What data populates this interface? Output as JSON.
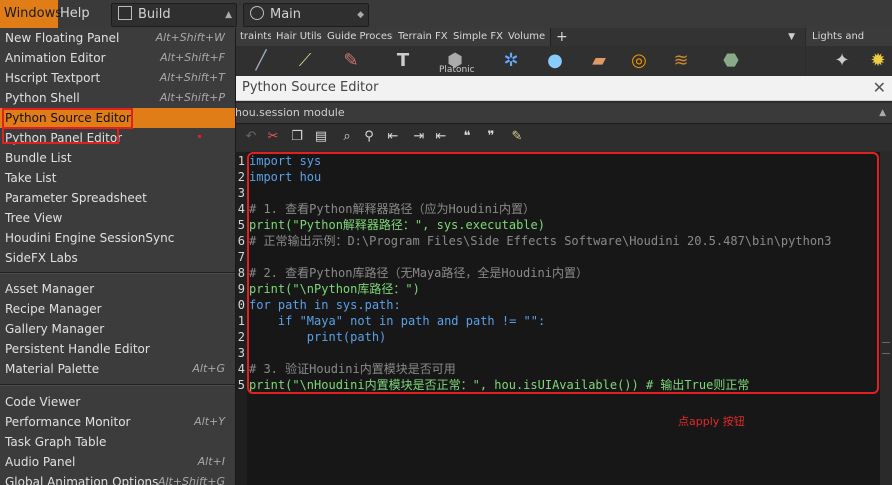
{
  "menubar": {
    "windows": "Windows",
    "help": "Help",
    "desktop_dropdown": "Build",
    "pane_dropdown": "Main"
  },
  "shelf": {
    "tabs": [
      "traints",
      "Hair Utils",
      "Guide Process",
      "Terrain FX",
      "Simple FX",
      "Volume"
    ],
    "add_label": "+",
    "visible_tool_label": "Platonic",
    "second_tab": "Lights and Cameras"
  },
  "menu": {
    "items": [
      {
        "label": "New Floating Panel",
        "shortcut": "Alt+Shift+W"
      },
      {
        "label": "Animation Editor",
        "shortcut": "Alt+Shift+F"
      },
      {
        "label": "Hscript Textport",
        "shortcut": "Alt+Shift+T"
      },
      {
        "label": "Python Shell",
        "shortcut": "Alt+Shift+P"
      },
      {
        "label": "Python Source Editor",
        "shortcut": ""
      },
      {
        "label": "Python Panel Editor",
        "shortcut": ""
      },
      {
        "label": "Bundle List",
        "shortcut": ""
      },
      {
        "label": "Take List",
        "shortcut": ""
      },
      {
        "label": "Parameter Spreadsheet",
        "shortcut": ""
      },
      {
        "label": "Tree View",
        "shortcut": ""
      },
      {
        "label": "Houdini Engine SessionSync",
        "shortcut": ""
      },
      {
        "label": "SideFX Labs",
        "shortcut": ""
      },
      {
        "label": "Asset Manager",
        "shortcut": ""
      },
      {
        "label": "Recipe Manager",
        "shortcut": ""
      },
      {
        "label": "Gallery Manager",
        "shortcut": ""
      },
      {
        "label": "Persistent Handle Editor",
        "shortcut": ""
      },
      {
        "label": "Material Palette",
        "shortcut": "Alt+G"
      },
      {
        "label": "Code Viewer",
        "shortcut": ""
      },
      {
        "label": "Performance Monitor",
        "shortcut": "Alt+Y"
      },
      {
        "label": "Task Graph Table",
        "shortcut": ""
      },
      {
        "label": "Audio Panel",
        "shortcut": "Alt+I"
      },
      {
        "label": "Global Animation Options",
        "shortcut": "Alt+Shift+G"
      }
    ]
  },
  "pane": {
    "title": "Python Source Editor",
    "close": "✕",
    "module": "hou.session module"
  },
  "editor": {
    "line_numbers": [
      "1",
      "2",
      "3",
      "4",
      "5",
      "6",
      "7",
      "8",
      "9",
      "0",
      "1",
      "2",
      "3",
      "4",
      "5"
    ],
    "lines": [
      "import sys",
      "import hou",
      "",
      "# 1. 查看Python解释器路径（应为Houdini内置）",
      "print(\"Python解释器路径：\", sys.executable)",
      "# 正常输出示例：D:\\Program Files\\Side Effects Software\\Houdini 20.5.487\\bin\\python3",
      "",
      "# 2. 查看Python库路径（无Maya路径，全是Houdini内置）",
      "print(\"\\nPython库路径：\")",
      "for path in sys.path:",
      "    if \"Maya\" not in path and path != \"\":",
      "        print(path)",
      "",
      "# 3. 验证Houdini内置模块是否可用",
      "print(\"\\nHoudini内置模块是否正常：\", hou.isUIAvailable()) # 输出True则正常"
    ]
  },
  "annotation": "点apply 按钮",
  "colors": {
    "accent": "#e07d16",
    "highlight_box": "#e32020"
  }
}
